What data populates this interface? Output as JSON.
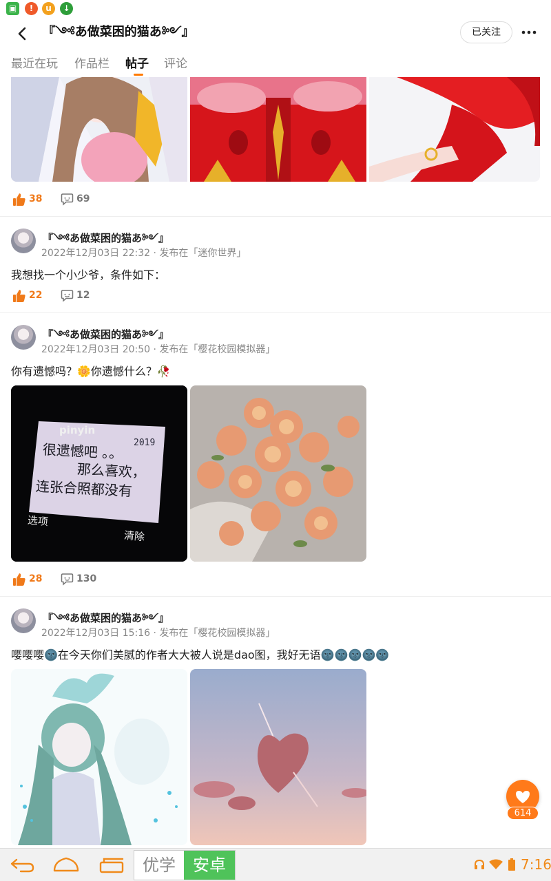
{
  "header": {
    "title": "『༺あ做菜困的猫あ༻』",
    "follow_label": "已关注"
  },
  "tabs": [
    {
      "label": "最近在玩",
      "active": false
    },
    {
      "label": "作品栏",
      "active": false
    },
    {
      "label": "帖子",
      "active": true
    },
    {
      "label": "评论",
      "active": false
    }
  ],
  "posts": [
    {
      "likes": "38",
      "comments": "69"
    },
    {
      "author": "『༺あ做菜困的猫あ༻』",
      "meta": "2022年12月03日 22:32 · 发布在「迷你世界」",
      "text": "我想找一个小少爷，条件如下：",
      "likes": "22",
      "comments": "12"
    },
    {
      "author": "『༺あ做菜困的猫あ༻』",
      "meta": "2022年12月03日 20:50 · 发布在「樱花校园模拟器」",
      "text": "你有遗憾吗？🌼你遗憾什么？🥀",
      "image_text": {
        "brand": "pinyin",
        "year": "2019",
        "line1": "很遗憾吧 。。",
        "line2": "那么喜欢，",
        "line3": "连张合照都没有",
        "left_soft": "选项",
        "right_soft": "清除"
      },
      "likes": "28",
      "comments": "130"
    },
    {
      "author": "『༺あ做菜困的猫あ༻』",
      "meta": "2022年12月03日 15:16 · 发布在「樱花校园模拟器」",
      "text": "嘤嘤嘤🌚在今天你们美腻的作者大大被人说是dao图，我好无语🌚🌚🌚🌚🌚"
    }
  ],
  "floating_like": {
    "count": "614"
  },
  "system_nav": {
    "ime_left": "优学",
    "ime_right": "安卓",
    "clock": "7:16"
  },
  "colors": {
    "accent": "#ff7a1a",
    "tab_underline": "#ff7a00",
    "ime_green": "#4fc35a"
  }
}
